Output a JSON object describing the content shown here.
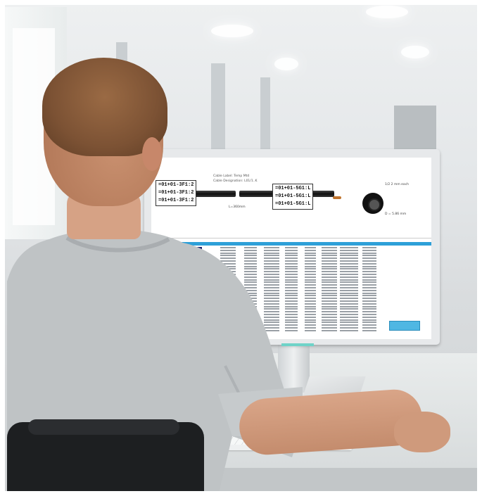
{
  "scene": {
    "description_colors": {
      "shirt": "#bfc3c5",
      "skin": "#c98f70",
      "hair": "#7c5234",
      "monitor": "#e7e9eb",
      "accent": "#2ea0d8"
    }
  },
  "monitor_app": {
    "title": "",
    "header_line_1": "Cable Label: Temp Mtd",
    "header_line_2": "Cable Designation: L01/1..K",
    "left_labels": [
      "=01+01-3F1:2",
      "=01+01-3F1:2",
      "=01+01-3F1:2"
    ],
    "right_labels": [
      "=01+01-5G1:L",
      "=01+01-5G1:L",
      "=01+01-5G1:L"
    ],
    "length_label": "L=360mm",
    "cross_section_label": "1/2 2 mm each",
    "diameter_label": "D = 5.86 mm"
  }
}
